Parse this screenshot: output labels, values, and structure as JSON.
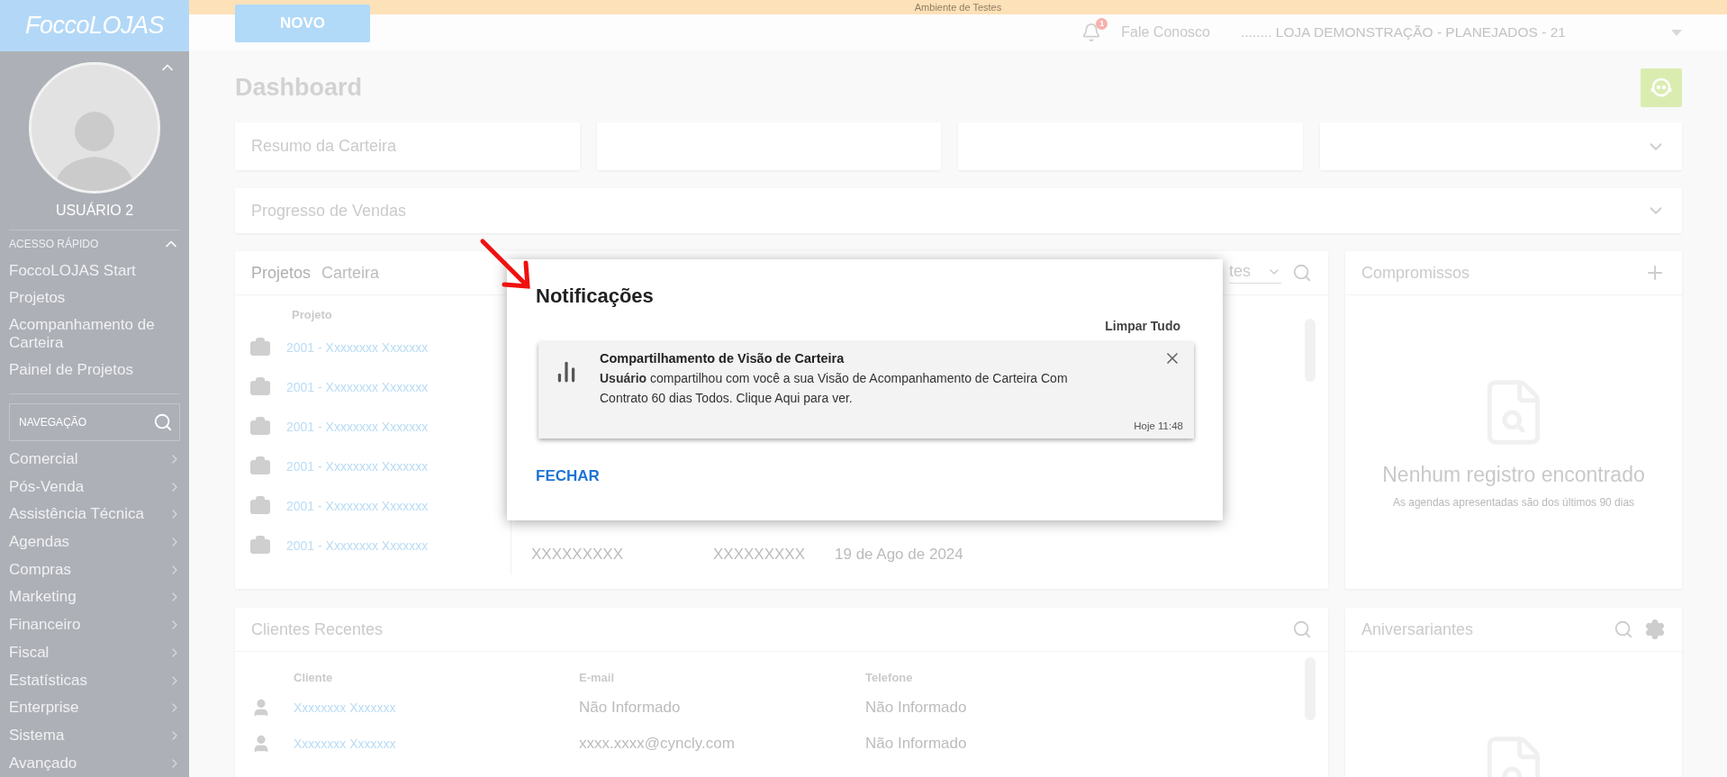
{
  "environment_banner": "Ambiente de Testes",
  "sidebar": {
    "logo": "**Focco**LOJAS",
    "user_name": "USUÁRIO 2",
    "quick_access": {
      "title": "ACESSO RÁPIDO",
      "expanded": true,
      "items": [
        "FoccoLOJAS Start",
        "Projetos",
        "Acompanhamento de Carteira",
        "Painel de Projetos"
      ]
    },
    "nav_search": {
      "placeholder": "NAVEGAÇÃO"
    },
    "menu": [
      "Comercial",
      "Pós-Venda",
      "Assistência Técnica",
      "Agendas",
      "Compras",
      "Marketing",
      "Financeiro",
      "Fiscal",
      "Estatísticas",
      "Enterprise",
      "Sistema",
      "Avançado"
    ]
  },
  "header": {
    "new_button": "NOVO",
    "notification_count": "1",
    "contact_link": "Fale Conosco",
    "store": "........ LOJA DEMONSTRAÇÃO - PLANEJADOS - 21"
  },
  "page_title": "Dashboard",
  "summary_cards": [
    {
      "title": "Resumo da Carteira",
      "collapsible": false
    },
    {
      "collapsible": false
    },
    {
      "collapsible": false
    },
    {
      "collapsible": true
    }
  ],
  "progress_card": {
    "title": "Progresso de Vendas"
  },
  "projects_card": {
    "tabs": [
      {
        "label": "Projetos",
        "selected": true
      },
      {
        "label": "Carteira",
        "selected": false
      }
    ],
    "filter_value": "tes",
    "column_1": "Projeto",
    "rows": [
      "2001 - Xxxxxxxx Xxxxxxx",
      "2001 - Xxxxxxxx Xxxxxxx",
      "2001 - Xxxxxxxx Xxxxxxx",
      "2001 - Xxxxxxxx Xxxxxxx",
      "2001 - Xxxxxxxx Xxxxxxx",
      "2001 - Xxxxxxxx Xxxxxxx"
    ],
    "last_row_cells": [
      "XXXXXXXXX",
      "XXXXXXXXX",
      "19 de Ago de 2024"
    ]
  },
  "appointments_card": {
    "title": "Compromissos",
    "empty_title": "Nenhum registro encontrado",
    "empty_subtitle": "As agendas apresentadas são dos últimos 90 dias"
  },
  "clients_card": {
    "title": "Clientes Recentes",
    "columns": [
      "Cliente",
      "E-mail",
      "Telefone"
    ],
    "rows": [
      {
        "name": "Xxxxxxxx Xxxxxxx",
        "email": "Não Informado",
        "phone": "Não Informado"
      },
      {
        "name": "Xxxxxxxx Xxxxxxx",
        "email": "xxxx.xxxx@cyncly.com",
        "phone": "Não Informado"
      }
    ]
  },
  "birthdays_card": {
    "title": "Aniversariantes"
  },
  "notifications_dialog": {
    "title": "Notificações",
    "clear_all": "Limpar Tudo",
    "items": [
      {
        "title": "Compartilhamento de Visão de Carteira",
        "message": "**Usuário** compartilhou com você a sua Visão de Acompanhamento de Carteira Com Contrato 60 dias Todos. Clique Aqui para ver.",
        "time": "Hoje 11:48"
      }
    ],
    "close_button": "FECHAR"
  }
}
